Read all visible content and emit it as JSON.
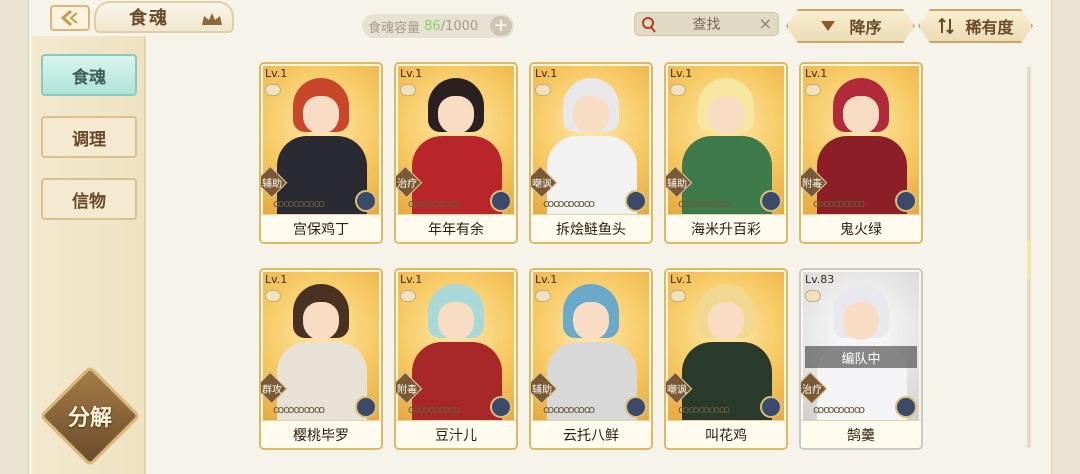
{
  "header": {
    "title": "食魂",
    "capacity_label": "食魂容量",
    "capacity_current": "86",
    "capacity_max": "/1000",
    "capacity_add": "+",
    "search_placeholder": "查找",
    "search_clear": "×",
    "sort_label": "降序",
    "rarity_label": "稀有度"
  },
  "sidebar": {
    "tabs": [
      {
        "label": "食魂",
        "active": true
      },
      {
        "label": "调理",
        "active": false
      },
      {
        "label": "信物",
        "active": false
      }
    ],
    "decompose_label": "分解"
  },
  "cards": [
    {
      "level": "Lv.1",
      "role": "辅助",
      "stars": "ꝏꝏꝏꝏꝏ",
      "name": "宫保鸡丁",
      "hair": "#c8472a",
      "body": "#2a2a32",
      "rarity": "gold"
    },
    {
      "level": "Lv.1",
      "role": "治疗",
      "stars": "ꝏꝏꝏꝏꝏ",
      "name": "年年有余",
      "hair": "#2a2020",
      "body": "#b8262a",
      "rarity": "gold"
    },
    {
      "level": "Lv.1",
      "role": "嘲讽",
      "stars": "ꝏꝏꝏꝏꝏ",
      "name": "拆烩鲢鱼头",
      "hair": "#e8e8e8",
      "body": "#f2f2f2",
      "rarity": "gold"
    },
    {
      "level": "Lv.1",
      "role": "辅助",
      "stars": "ꝏꝏꝏꝏꝏ",
      "name": "海米升百彩",
      "hair": "#f6e6a0",
      "body": "#3e7a4a",
      "rarity": "gold"
    },
    {
      "level": "Lv.1",
      "role": "附毒",
      "stars": "ꝏꝏꝏꝏꝏ",
      "name": "鬼火绿",
      "hair": "#b02a3a",
      "body": "#8c1e28",
      "rarity": "gold"
    },
    {
      "level": "Lv.1",
      "role": "群攻",
      "stars": "ꝏꝏꝏꝏꝏ",
      "name": "樱桃毕罗",
      "hair": "#4a3222",
      "body": "#e8e2d6",
      "rarity": "gold"
    },
    {
      "level": "Lv.1",
      "role": "附毒",
      "stars": "ꝏꝏꝏꝏꝏ",
      "name": "豆汁儿",
      "hair": "#a8d8d8",
      "body": "#a8282a",
      "rarity": "gold"
    },
    {
      "level": "Lv.1",
      "role": "辅助",
      "stars": "ꝏꝏꝏꝏꝏ",
      "name": "云托八鲜",
      "hair": "#6aaac8",
      "body": "#d8d8d8",
      "rarity": "gold"
    },
    {
      "level": "Lv.1",
      "role": "嘲讽",
      "stars": "ꝏꝏꝏꝏꝏ",
      "name": "叫花鸡",
      "hair": "#f0d890",
      "body": "#2a3a2a",
      "rarity": "gold"
    },
    {
      "level": "Lv.83",
      "role": "治疗",
      "stars": "ꝏꝏꝏꝏꝏ",
      "name": "鹄羹",
      "hair": "#e8e8ee",
      "body": "#f4f4f6",
      "rarity": "silver",
      "status": "编队中"
    }
  ],
  "colors": {
    "accent_gold": "#e0b763",
    "active_tab": "#aee3d9",
    "capacity_current": "#8bd16a"
  }
}
